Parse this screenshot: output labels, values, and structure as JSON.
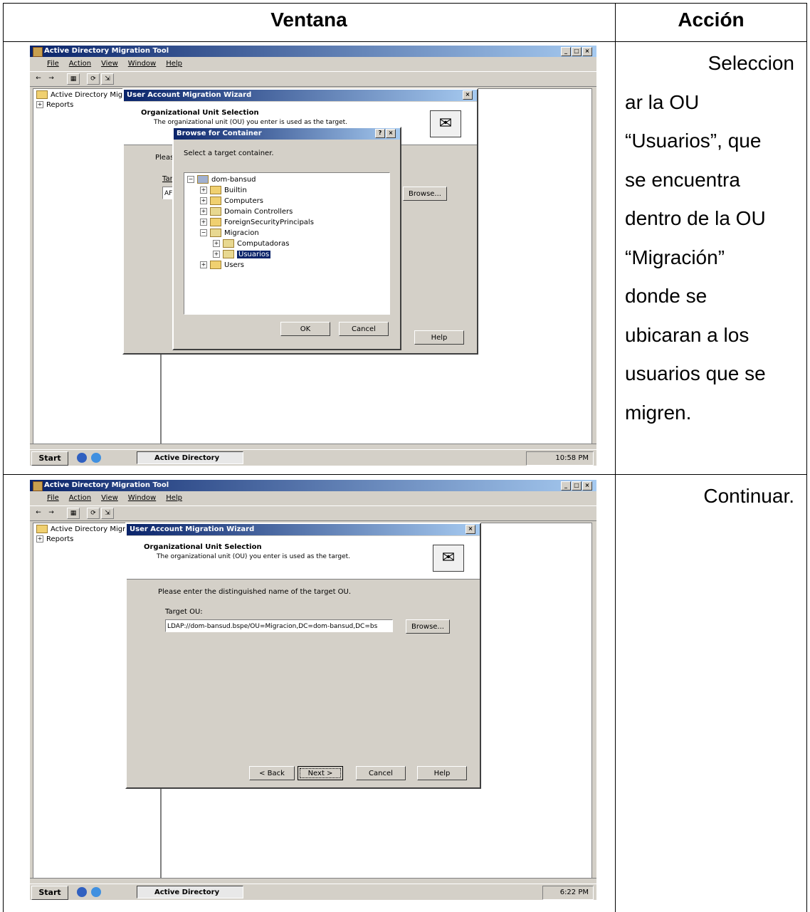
{
  "table": {
    "header_window": "Ventana",
    "header_action": "Acción",
    "rows": [
      {
        "action_lines": [
          "Seleccion",
          "ar la OU",
          "“Usuarios”, que",
          "se encuentra",
          "dentro de la OU",
          "“Migración”",
          "donde se",
          "ubicaran a  los",
          "usuarios que se",
          "migren."
        ]
      },
      {
        "action_lines": [
          "Continuar."
        ]
      }
    ]
  },
  "screens": [
    {
      "app_title": "Active Directory Migration Tool",
      "menu": [
        "File",
        "Action",
        "View",
        "Window",
        "Help"
      ],
      "tree_root": "Active Directory Migrat",
      "tree_child": "Reports",
      "wizard_title": "User Account Migration Wizard",
      "wizard_heading": "Organizational Unit Selection",
      "wizard_subheading": "The organizational unit (OU) you enter is used as the target.",
      "wizard_prompt": "Pleas",
      "target_label": "Tar",
      "target_value": "AF",
      "browse_button": "Browse...",
      "help_button": "Help",
      "browse_dialog": {
        "title": "Browse for Container",
        "help_mark": "?",
        "close": "×",
        "prompt": "Select a target container.",
        "nodes": [
          "dom-bansud",
          "Builtin",
          "Computers",
          "Domain Controllers",
          "ForeignSecurityPrincipals",
          "Migracion",
          "Computadoras",
          "Usuarios",
          "Users"
        ],
        "ok": "OK",
        "cancel": "Cancel"
      },
      "start": "Start",
      "task": "Active Directory Migr...",
      "clock": "10:58 PM"
    },
    {
      "app_title": "Active Directory Migration Tool",
      "menu": [
        "File",
        "Action",
        "View",
        "Window",
        "Help"
      ],
      "tree_root": "Active Directory Migrati",
      "tree_child": "Reports",
      "wizard_title": "User Account Migration Wizard",
      "wizard_heading": "Organizational Unit Selection",
      "wizard_subheading": "The organizational unit (OU) you enter is used as the target.",
      "wizard_prompt": "Please enter the distinguished name of the target OU.",
      "target_label": "Target OU:",
      "target_value": "LDAP://dom-bansud.bspe/OU=Migracion,DC=dom-bansud,DC=bs",
      "browse_button": "Browse...",
      "back_button": "< Back",
      "next_button": "Next >",
      "cancel_button": "Cancel",
      "help_button": "Help",
      "start": "Start",
      "task": "Active Directory Migr...",
      "clock": "6:22 PM"
    }
  ]
}
